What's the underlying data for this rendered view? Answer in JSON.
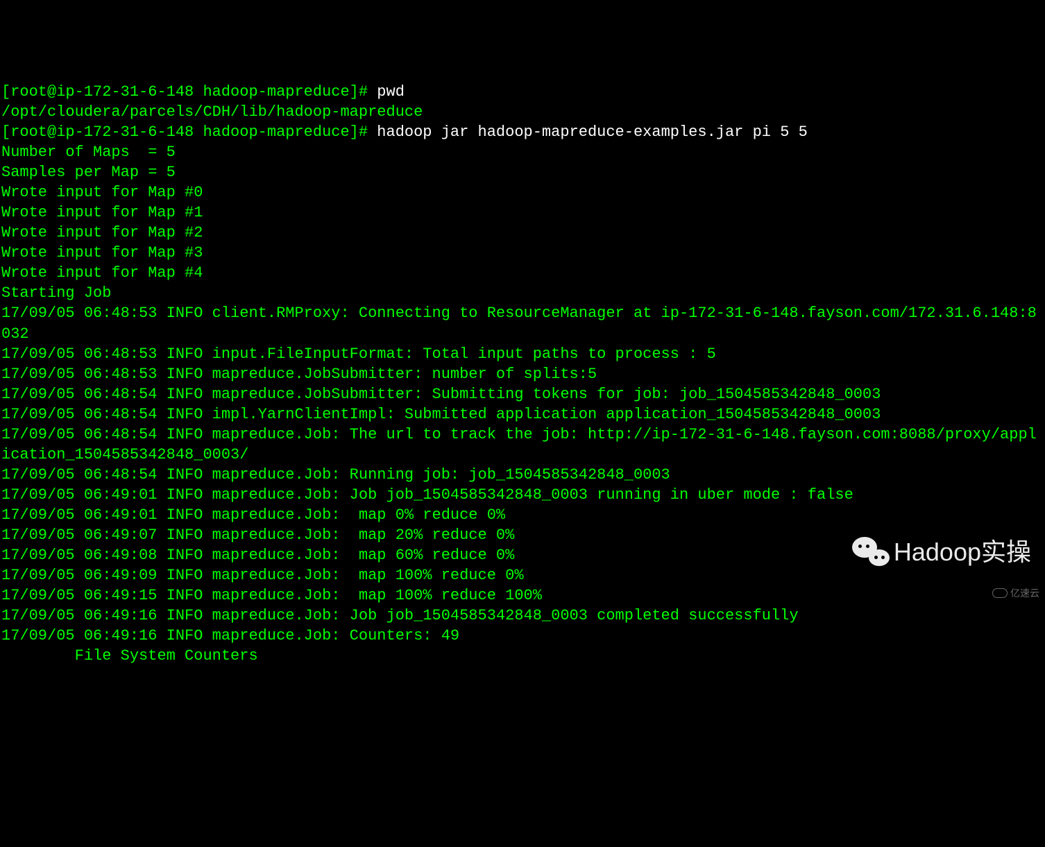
{
  "terminal": {
    "prompt1": "[root@ip-172-31-6-148 hadoop-mapreduce]# ",
    "cmd1": "pwd",
    "output1": "/opt/cloudera/parcels/CDH/lib/hadoop-mapreduce",
    "prompt2": "[root@ip-172-31-6-148 hadoop-mapreduce]# ",
    "cmd2": "hadoop jar hadoop-mapreduce-examples.jar pi 5 5",
    "lines": [
      "Number of Maps  = 5",
      "Samples per Map = 5",
      "Wrote input for Map #0",
      "Wrote input for Map #1",
      "Wrote input for Map #2",
      "Wrote input for Map #3",
      "Wrote input for Map #4",
      "Starting Job",
      "17/09/05 06:48:53 INFO client.RMProxy: Connecting to ResourceManager at ip-172-31-6-148.fayson.com/172.31.6.148:8032",
      "17/09/05 06:48:53 INFO input.FileInputFormat: Total input paths to process : 5",
      "17/09/05 06:48:53 INFO mapreduce.JobSubmitter: number of splits:5",
      "17/09/05 06:48:54 INFO mapreduce.JobSubmitter: Submitting tokens for job: job_1504585342848_0003",
      "17/09/05 06:48:54 INFO impl.YarnClientImpl: Submitted application application_1504585342848_0003",
      "17/09/05 06:48:54 INFO mapreduce.Job: The url to track the job: http://ip-172-31-6-148.fayson.com:8088/proxy/application_1504585342848_0003/",
      "17/09/05 06:48:54 INFO mapreduce.Job: Running job: job_1504585342848_0003",
      "17/09/05 06:49:01 INFO mapreduce.Job: Job job_1504585342848_0003 running in uber mode : false",
      "17/09/05 06:49:01 INFO mapreduce.Job:  map 0% reduce 0%",
      "17/09/05 06:49:07 INFO mapreduce.Job:  map 20% reduce 0%",
      "17/09/05 06:49:08 INFO mapreduce.Job:  map 60% reduce 0%",
      "17/09/05 06:49:09 INFO mapreduce.Job:  map 100% reduce 0%",
      "17/09/05 06:49:15 INFO mapreduce.Job:  map 100% reduce 100%",
      "17/09/05 06:49:16 INFO mapreduce.Job: Job job_1504585342848_0003 completed successfully",
      "17/09/05 06:49:16 INFO mapreduce.Job: Counters: 49",
      "        File System Counters"
    ]
  },
  "watermark": {
    "text": "Hadoop实操",
    "text2": "亿速云"
  }
}
